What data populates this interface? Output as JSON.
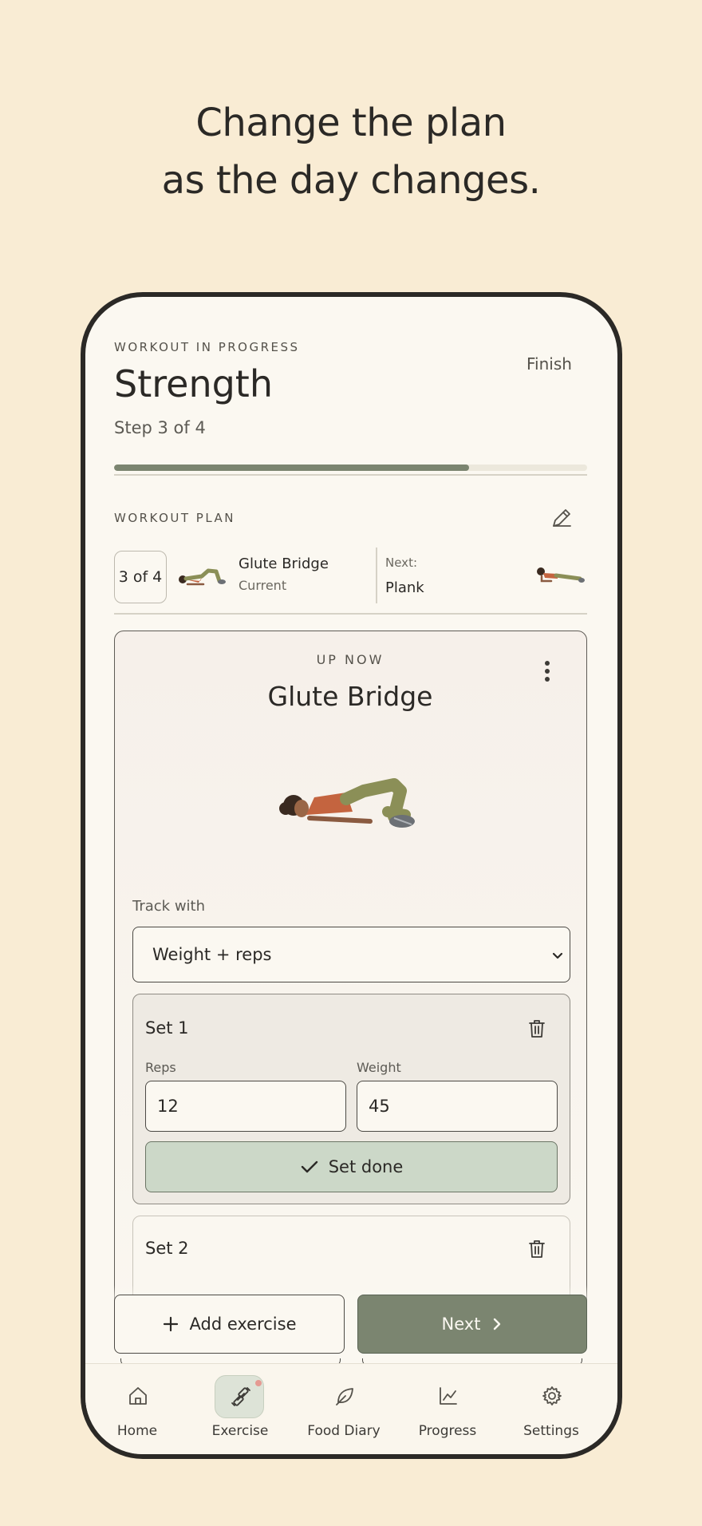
{
  "headline": {
    "line1": "Change the plan",
    "line2": "as the day changes."
  },
  "workout": {
    "eyebrow": "WORKOUT IN PROGRESS",
    "title": "Strength",
    "step": "Step 3 of 4",
    "finish_label": "Finish",
    "progress": 0.75
  },
  "plan": {
    "label": "WORKOUT PLAN",
    "count": "3 of 4",
    "current_name": "Glute Bridge",
    "current_status": "Current",
    "next_label": "Next:",
    "next_name": "Plank"
  },
  "exercise": {
    "up_now": "UP NOW",
    "title": "Glute Bridge",
    "track_label": "Track with",
    "track_value": "Weight + reps",
    "sets": [
      {
        "title": "Set 1",
        "reps_label": "Reps",
        "weight_label": "Weight",
        "reps": "12",
        "weight": "45",
        "done_label": "Set done"
      },
      {
        "title": "Set 2"
      }
    ]
  },
  "actions": {
    "add_label": "Add exercise",
    "next_label": "Next"
  },
  "nav": {
    "items": [
      {
        "label": "Home",
        "icon": "home-icon"
      },
      {
        "label": "Exercise",
        "icon": "dumbbell-icon",
        "active": true
      },
      {
        "label": "Food Diary",
        "icon": "leaf-icon"
      },
      {
        "label": "Progress",
        "icon": "chart-icon"
      },
      {
        "label": "Settings",
        "icon": "gear-icon"
      }
    ]
  },
  "colors": {
    "background": "#f9ecd4",
    "accent": "#7b8570",
    "set_done": "#ccd8c8"
  }
}
